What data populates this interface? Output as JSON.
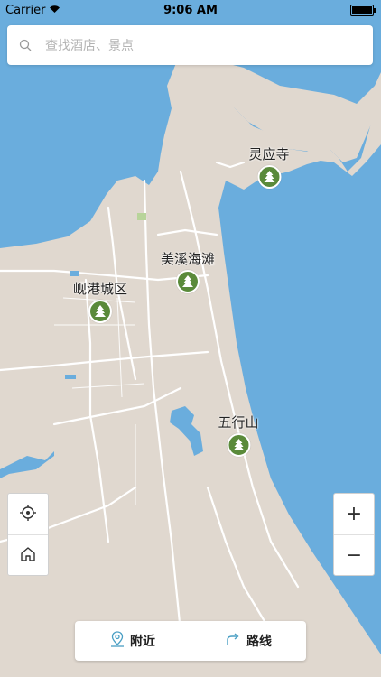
{
  "status_bar": {
    "carrier": "Carrier",
    "time": "9:06 AM"
  },
  "search": {
    "placeholder": "查找酒店、景点"
  },
  "pois": [
    {
      "name": "灵应寺",
      "icon": "tree-icon"
    },
    {
      "name": "美溪海滩",
      "icon": "tree-icon"
    },
    {
      "name": "岘港城区",
      "icon": "tree-icon"
    },
    {
      "name": "五行山",
      "icon": "tree-icon"
    }
  ],
  "controls": {
    "zoom_in": "+",
    "zoom_out": "−"
  },
  "bottom_bar": {
    "nearby_label": "附近",
    "route_label": "路线"
  },
  "colors": {
    "water": "#6aaddd",
    "land": "#e0d8cf",
    "road": "#ffffff",
    "poi_green": "#5a8a3a"
  }
}
